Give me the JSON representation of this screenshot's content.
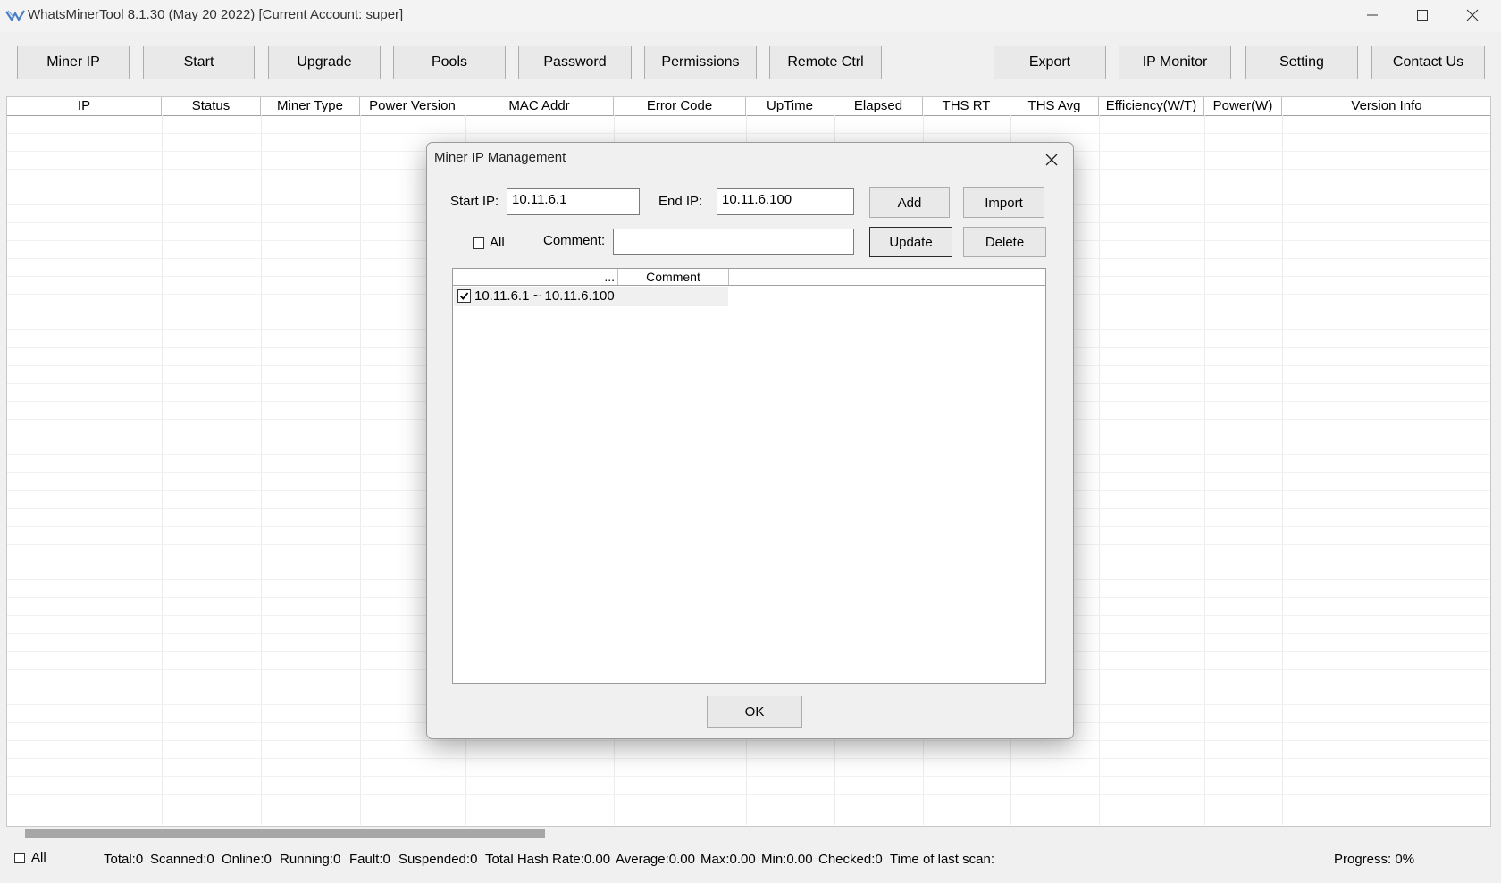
{
  "window": {
    "title": "WhatsMinerTool 8.1.30 (May 20 2022) [Current Account: super]"
  },
  "toolbar": {
    "left": [
      "Miner IP",
      "Start",
      "Upgrade",
      "Pools",
      "Password",
      "Permissions",
      "Remote Ctrl"
    ],
    "right": [
      "Export",
      "IP Monitor",
      "Setting",
      "Contact Us"
    ]
  },
  "grid": {
    "columns": [
      "IP",
      "Status",
      "Miner Type",
      "Power Version",
      "MAC Addr",
      "Error Code",
      "UpTime",
      "Elapsed",
      "THS RT",
      "THS Avg",
      "Efficiency(W/T)",
      "Power(W)",
      "Version Info"
    ]
  },
  "status": {
    "all_label": "All",
    "total": "Total:0",
    "scanned": "Scanned:0",
    "online": "Online:0",
    "running": "Running:0",
    "fault": "Fault:0",
    "suspended": "Suspended:0",
    "total_hash_rate": "Total Hash Rate:0.00",
    "average": "Average:0.00",
    "max": "Max:0.00",
    "min": "Min:0.00",
    "checked": "Checked:0",
    "last_scan": "Time of last scan:",
    "progress": "Progress: 0%"
  },
  "dialog": {
    "title": "Miner IP Management",
    "start_ip_label": "Start IP:",
    "start_ip_value": "10.11.6.1",
    "end_ip_label": "End IP:",
    "end_ip_value": "10.11.6.100",
    "all_label": "All",
    "comment_label": "Comment:",
    "comment_value": "",
    "add_label": "Add",
    "import_label": "Import",
    "update_label": "Update",
    "delete_label": "Delete",
    "list_columns": [
      "...",
      "Comment"
    ],
    "rows": [
      {
        "checked": true,
        "range": "10.11.6.1 ~ 10.11.6.100",
        "comment": ""
      }
    ],
    "ok_label": "OK"
  },
  "colors": {
    "window_bg": "#f0f0f0",
    "button_bg": "#e9e9e9",
    "button_border": "#adadad",
    "grid_bg": "#ffffff"
  }
}
